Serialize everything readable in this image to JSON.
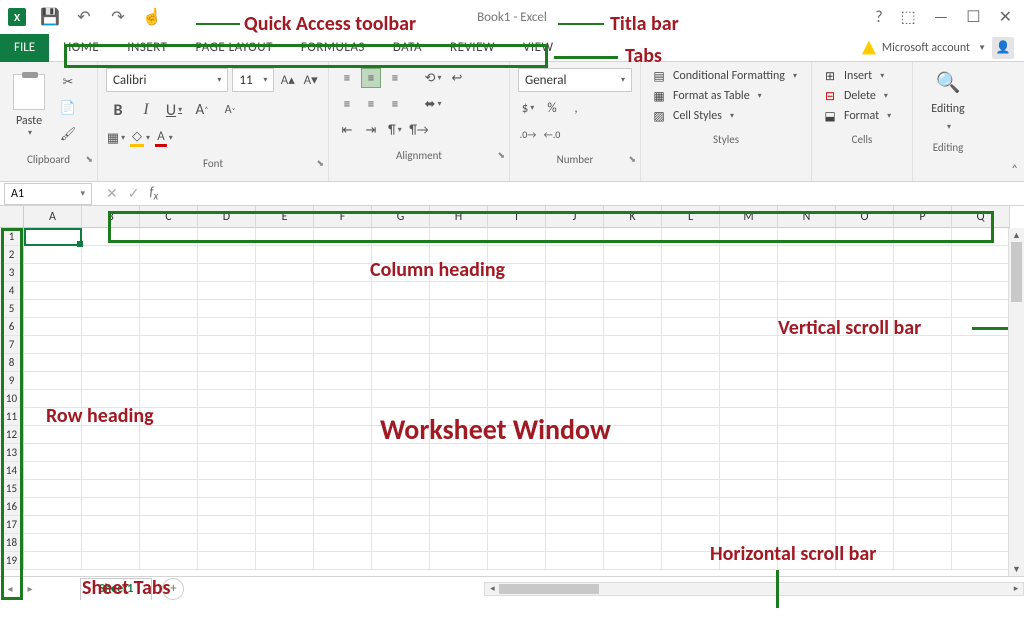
{
  "title": "Book1 - Excel",
  "file_tab": "FILE",
  "tabs": [
    "HOME",
    "INSERT",
    "PAGE LAYOUT",
    "FORMULAS",
    "DATA",
    "REVIEW",
    "VIEW"
  ],
  "account_label": "Microsoft account",
  "ribbon": {
    "clipboard": {
      "label": "Clipboard",
      "paste": "Paste"
    },
    "font": {
      "label": "Font",
      "name": "Calibri",
      "size": "11"
    },
    "alignment": {
      "label": "Alignment"
    },
    "number": {
      "label": "Number",
      "format": "General"
    },
    "styles": {
      "label": "Styles",
      "cond": "Conditional Formatting",
      "table": "Format as Table",
      "cellstyles": "Cell Styles"
    },
    "cells": {
      "label": "Cells",
      "insert": "Insert",
      "delete": "Delete",
      "format": "Format"
    },
    "editing": {
      "label": "Editing"
    }
  },
  "namebox": "A1",
  "columns": [
    "A",
    "B",
    "C",
    "D",
    "E",
    "F",
    "G",
    "H",
    "I",
    "J",
    "K",
    "L",
    "M",
    "N",
    "O",
    "P",
    "Q"
  ],
  "rows": [
    "1",
    "2",
    "3",
    "4",
    "5",
    "6",
    "7",
    "8",
    "9",
    "10",
    "11",
    "12",
    "13",
    "14",
    "15",
    "16",
    "17",
    "18",
    "19"
  ],
  "sheet": "Sheet1",
  "annotations": {
    "qat": "Quick Access toolbar",
    "titlebar": "Titla bar",
    "tabs": "Tabs",
    "colhead": "Column heading",
    "rowhead": "Row heading",
    "vscroll": "Vertical scroll bar",
    "hscroll": "Horizontal scroll bar",
    "sheettabs": "Sheet Tabs",
    "worksheet": "Worksheet Window"
  }
}
